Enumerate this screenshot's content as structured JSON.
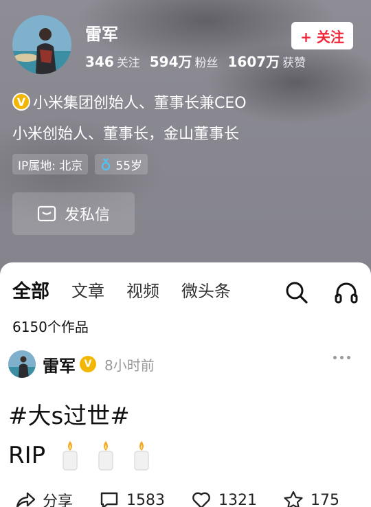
{
  "profile": {
    "name": "雷军",
    "follow_label": "+ 关注",
    "stats": [
      {
        "value": "346",
        "label": "关注"
      },
      {
        "value": "594万",
        "label": "粉丝"
      },
      {
        "value": "1607万",
        "label": "获赞"
      }
    ],
    "verification": "小米集团创始人、董事长兼CEO",
    "bio": "小米创始人、董事长，金山董事长",
    "tags": {
      "ip": "IP属地: 北京",
      "age": "55岁"
    },
    "message_label": "发私信"
  },
  "tabs": {
    "all": "全部",
    "articles": "文章",
    "videos": "视频",
    "micro": "微头条"
  },
  "works_count": "6150个作品",
  "post": {
    "author": "雷军",
    "time": "8小时前",
    "title": "#大s过世#",
    "body": "RIP",
    "share_label": "分享",
    "comments": "1583",
    "likes": "1321",
    "favorites": "175"
  },
  "colors": {
    "accent_red": "#f2273a",
    "verify_gold": "#f2b705"
  }
}
